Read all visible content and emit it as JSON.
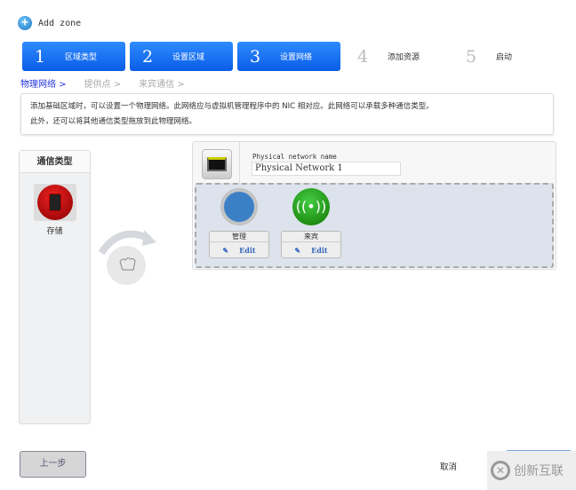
{
  "title": "Add zone",
  "steps": [
    {
      "num": "1",
      "label": "区域类型"
    },
    {
      "num": "2",
      "label": "设置区域"
    },
    {
      "num": "3",
      "label": "设置网络"
    },
    {
      "num": "4",
      "label": "添加资源"
    },
    {
      "num": "5",
      "label": "启动"
    }
  ],
  "subnav": [
    "物理网络 >",
    "提供点 >",
    "来宾通信 >"
  ],
  "description": [
    "添加基础区域时，可以设置一个物理网络。此网络应与虚拟机管理程序中的 NIC 相对应。此网络可以承载多种通信类型。",
    "此外，还可以将其他通信类型拖放到此物理网络。"
  ],
  "traffic_panel": {
    "title": "通信类型",
    "items": [
      {
        "label": "存储"
      }
    ]
  },
  "network": {
    "name_label": "Physical network name",
    "name_value": "Physical Network 1",
    "traffic": [
      {
        "label": "管理",
        "edit": "Edit"
      },
      {
        "label": "来宾",
        "edit": "Edit"
      }
    ]
  },
  "footer": {
    "prev": "上一步",
    "cancel": "取消"
  },
  "watermark": "创新互联"
}
